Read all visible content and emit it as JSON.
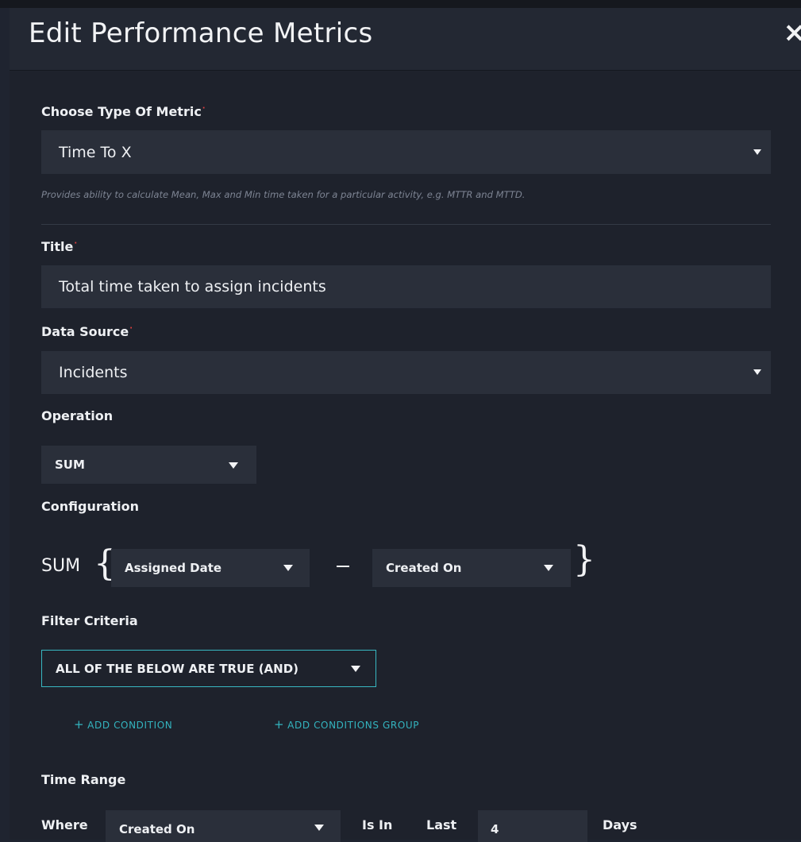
{
  "dialog": {
    "title": "Edit Performance Metrics",
    "close_glyph": "×"
  },
  "metric_type": {
    "label": "Choose Type Of Metric",
    "required_mark": "·",
    "value": "Time To X",
    "help": "Provides ability to calculate Mean, Max and Min time taken for a particular activity, e.g. MTTR and MTTD."
  },
  "title_field": {
    "label": "Title",
    "required_mark": "·",
    "value": "Total time taken to assign incidents"
  },
  "data_source": {
    "label": "Data Source",
    "required_mark": "·",
    "value": "Incidents"
  },
  "operation": {
    "label": "Operation",
    "value": "SUM"
  },
  "configuration": {
    "label": "Configuration",
    "operation": "SUM",
    "first_field": "Assigned Date",
    "second_field": "Created On"
  },
  "filter": {
    "label": "Filter Criteria",
    "value": "ALL OF THE BELOW ARE TRUE (AND)",
    "add_condition": "ADD CONDITION",
    "add_group": "ADD CONDITIONS GROUP",
    "plus_glyph": "+"
  },
  "time_range": {
    "label": "Time Range",
    "where_label": "Where",
    "field": "Created On",
    "is_in_label": "Is In",
    "last_label": "Last",
    "amount": "4",
    "unit_label": "Days"
  },
  "colors": {
    "background": "#1e222c",
    "field": "#2a2f3a",
    "accent": "#33b4bf",
    "required": "#e0403f"
  },
  "icons": [
    "close-icon",
    "chevron-down-icon",
    "plus-icon"
  ]
}
